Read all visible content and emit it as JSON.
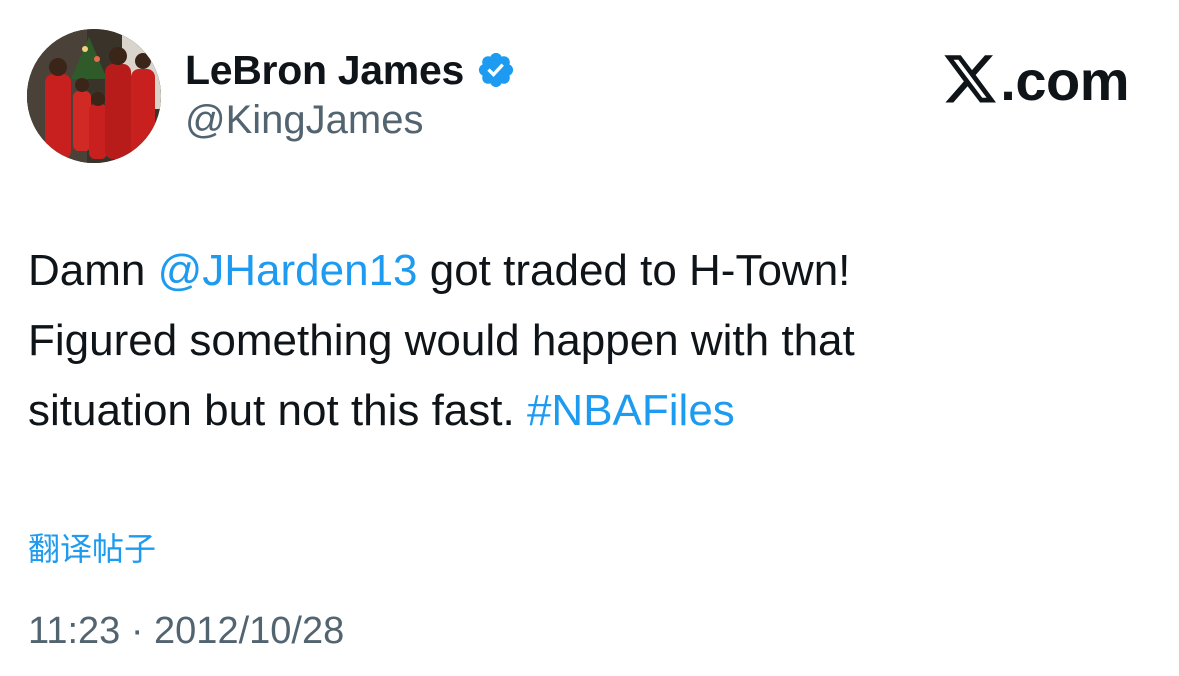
{
  "author": {
    "display_name": "LeBron James",
    "handle": "@KingJames",
    "verified": true,
    "verified_color": "#1d9bf0",
    "avatar_icon": "family-photo-avatar"
  },
  "brand": {
    "label": ".com",
    "icon": "x-logo-icon"
  },
  "tweet": {
    "line1": {
      "prefix": "Damn ",
      "mention": "@JHarden13",
      "suffix": " got traded to H-Town!"
    },
    "line2": "Figured something would happen with that",
    "line3": {
      "text": "situation but not this fast. ",
      "hashtag": "#NBAFiles"
    }
  },
  "translate_label": "翻译帖子",
  "timestamp": "11:23 · 2012/10/28",
  "colors": {
    "link": "#1d9bf0",
    "secondary_text": "#536471",
    "primary_text": "#0f1419"
  }
}
